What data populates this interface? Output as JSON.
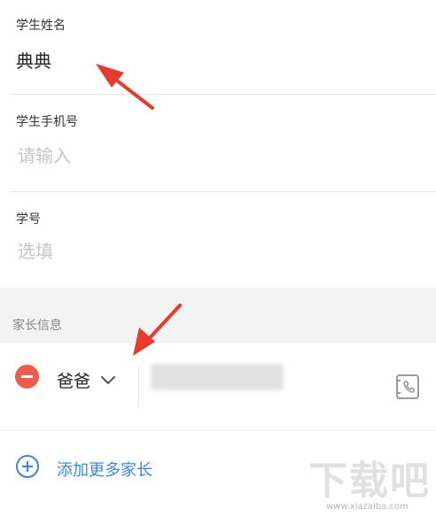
{
  "student_name": {
    "label": "学生姓名",
    "value": "典典"
  },
  "student_phone": {
    "label": "学生手机号",
    "placeholder": "请输入"
  },
  "student_id": {
    "label": "学号",
    "placeholder": "选填"
  },
  "parent_section": {
    "title": "家长信息"
  },
  "parent_entry": {
    "relation": "爸爸"
  },
  "add_parent": {
    "label": "添加更多家长"
  },
  "watermark": {
    "brand": "下载吧",
    "url": "www.xiazaiba.com"
  },
  "colors": {
    "remove": "#ef5c4e",
    "accent": "#3d86e0",
    "arrow": "#e63b2e",
    "section_bg": "#f3f3f3"
  },
  "icons": {
    "remove": "minus-circle-icon",
    "dropdown": "chevron-down-icon",
    "contacts": "contact-book-icon",
    "add": "plus-circle-icon"
  }
}
